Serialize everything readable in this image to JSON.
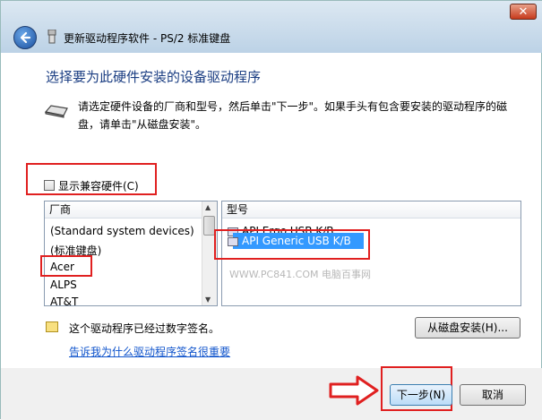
{
  "window": {
    "title": "更新驱动程序软件 - PS/2 标准键盘",
    "close_glyph": "✕"
  },
  "heading": "选择要为此硬件安装的设备驱动程序",
  "instruction": "请选定硬件设备的厂商和型号，然后单击\"下一步\"。如果手头有包含要安装的驱动程序的磁盘，请单击\"从磁盘安装\"。",
  "compat_checkbox": {
    "label": "显示兼容硬件(C)",
    "checked": false
  },
  "manufacturer_list": {
    "header": "厂商",
    "items": [
      "(Standard system devices)",
      "(标准键盘)",
      "Acer",
      "ALPS",
      "AT&T"
    ],
    "highlighted": "Acer"
  },
  "model_list": {
    "header": "型号",
    "items": [
      "API Ergo USB K/B",
      "API Generic USB K/B"
    ],
    "selected": "API Generic USB K/B"
  },
  "watermark": "WWW.PC841.COM 电脑百事网",
  "signature_text": "这个驱动程序已经过数字签名。",
  "signature_link": "告诉我为什么驱动程序签名很重要",
  "buttons": {
    "have_disk": "从磁盘安装(H)...",
    "next": "下一步(N)",
    "cancel": "取消"
  },
  "colors": {
    "heading": "#1a3d82",
    "highlight_box": "#e02020",
    "selection": "#3399ff",
    "link": "#1155cc"
  }
}
